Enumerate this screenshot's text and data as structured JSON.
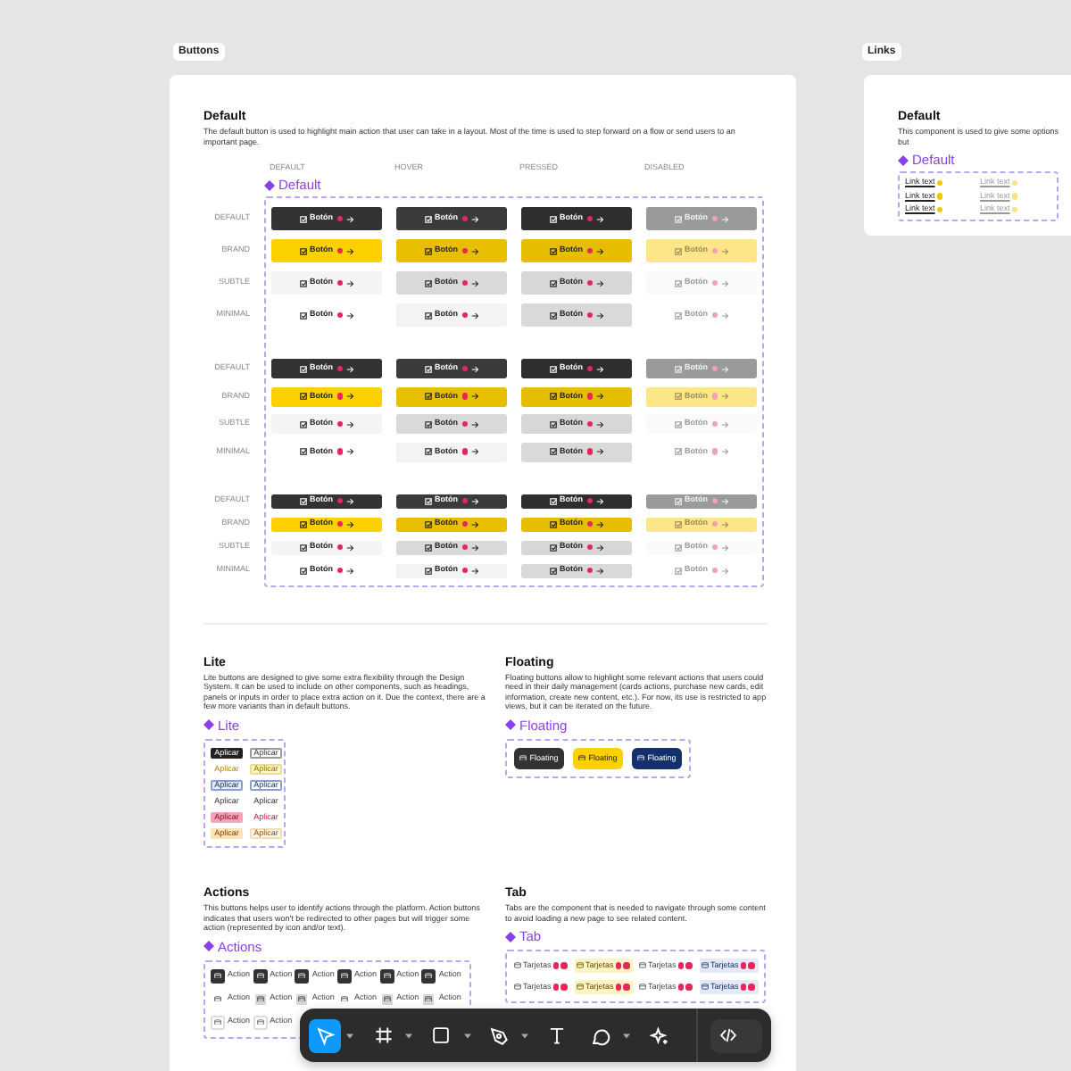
{
  "frames": [
    {
      "kind": "buttons",
      "label": "Buttons"
    },
    {
      "kind": "links",
      "label": "Links"
    }
  ],
  "buttons_page": {
    "default": {
      "title": "Default",
      "description": "The default button is used to highlight main action that user can take in a layout. Most of the time is used to step forward on a flow or send users to an important page.",
      "component": "Default",
      "columns": [
        {
          "label": "DEFAULT"
        },
        {
          "label": "HOVER"
        },
        {
          "label": "PRESSED"
        },
        {
          "label": "DISABLED"
        }
      ],
      "groups": [
        {
          "kind": "large",
          "rows": [
            {
              "label": "DEFAULT",
              "kind": "default",
              "buttons": [
                "Botón",
                "Botón",
                "Botón",
                "Botón"
              ]
            },
            {
              "label": "BRAND",
              "kind": "brand",
              "buttons": [
                "Botón",
                "Botón",
                "Botón",
                "Botón"
              ]
            },
            {
              "label": "SUBTLE",
              "kind": "subtle",
              "buttons": [
                "Botón",
                "Botón",
                "Botón",
                "Botón"
              ]
            },
            {
              "label": "MINIMAL",
              "kind": "minimal",
              "buttons": [
                "Botón",
                "Botón",
                "Botón",
                "Botón"
              ]
            }
          ]
        },
        {
          "kind": "medium",
          "rows": [
            {
              "label": "DEFAULT",
              "kind": "default",
              "buttons": [
                "Botón",
                "Botón",
                "Botón",
                "Botón"
              ]
            },
            {
              "label": "BRAND",
              "kind": "brand",
              "buttons": [
                "Botón",
                "Botón",
                "Botón",
                "Botón"
              ]
            },
            {
              "label": "SUBTLE",
              "kind": "subtle",
              "buttons": [
                "Botón",
                "Botón",
                "Botón",
                "Botón"
              ]
            },
            {
              "label": "MINIMAL",
              "kind": "minimal",
              "buttons": [
                "Botón",
                "Botón",
                "Botón",
                "Botón"
              ]
            }
          ]
        },
        {
          "kind": "small",
          "rows": [
            {
              "label": "DEFAULT",
              "kind": "default",
              "buttons": [
                "Botón",
                "Botón",
                "Botón",
                "Botón"
              ]
            },
            {
              "label": "BRAND",
              "kind": "brand",
              "buttons": [
                "Botón",
                "Botón",
                "Botón",
                "Botón"
              ]
            },
            {
              "label": "SUBTLE",
              "kind": "subtle",
              "buttons": [
                "Botón",
                "Botón",
                "Botón",
                "Botón"
              ]
            },
            {
              "label": "MINIMAL",
              "kind": "minimal",
              "buttons": [
                "Botón",
                "Botón",
                "Botón",
                "Botón"
              ]
            }
          ]
        }
      ]
    },
    "lite": {
      "title": "Lite",
      "description": "Lite buttons are designed to give some extra flexibility through the Design System. It can be used to include on other components, such as headings, panels or inputs in order to place extra action on it. Due the context, there are a few more variants than in default buttons.",
      "component": "Lite",
      "rows": [
        {
          "kind": "dark",
          "buttons": [
            "Aplicar",
            "Aplicar"
          ]
        },
        {
          "kind": "yellow",
          "buttons": [
            "Aplicar",
            "Aplicar"
          ]
        },
        {
          "kind": "blue",
          "buttons": [
            "Aplicar",
            "Aplicar"
          ]
        },
        {
          "kind": "plain",
          "buttons": [
            "Aplicar",
            "Aplicar"
          ]
        },
        {
          "kind": "pink",
          "buttons": [
            "Aplicar",
            "Aplicar"
          ]
        },
        {
          "kind": "orange",
          "buttons": [
            "Aplicar",
            "Aplicar"
          ]
        }
      ]
    },
    "floating": {
      "title": "Floating",
      "description": "Floating buttons allow to highlight some relevant actions that users could need in their daily management (cards actions, purchase new cards, edit information, create new content, etc.). For now, its use is restricted to app views, but it can be iterated on the future.",
      "component": "Floating",
      "buttons": [
        {
          "kind": "dark",
          "text": "Floating"
        },
        {
          "kind": "yellow",
          "text": "Floating"
        },
        {
          "kind": "navy",
          "text": "Floating"
        }
      ]
    },
    "actions": {
      "title": "Actions",
      "description": "This buttons helps user to identify actions through the platform. Action buttons indicates that users won't be redirected to other pages but will trigger some action (represented by icon and/or text).",
      "component": "Actions",
      "rows": [
        {
          "kind": "dark",
          "buttons": [
            "Action",
            "Action",
            "Action",
            "Action",
            "Action",
            "Action"
          ]
        },
        {
          "kind": "light",
          "buttons": [
            "Action",
            "Action",
            "Action",
            "Action",
            "Action",
            "Action"
          ]
        },
        {
          "kind": "plain",
          "buttons": [
            "Action",
            "Action"
          ]
        }
      ]
    },
    "tab": {
      "title": "Tab",
      "description": "Tabs are the component that is needed to navigate through some content to avoid loading a new page to see related content.",
      "component": "Tab",
      "rows": [
        {
          "tabs": [
            {
              "text": "Tarjetas",
              "kind": "plain"
            },
            {
              "text": "Tarjetas",
              "kind": "yellow"
            },
            {
              "text": "Tarjetas",
              "kind": "plain"
            },
            {
              "text": "Tarjetas",
              "kind": "blue"
            }
          ]
        },
        {
          "tabs": [
            {
              "text": "Tarjetas",
              "kind": "plain"
            },
            {
              "text": "Tarjetas",
              "kind": "yellow"
            },
            {
              "text": "Tarjetas",
              "kind": "plain"
            },
            {
              "text": "Tarjetas",
              "kind": "blue"
            }
          ]
        }
      ]
    }
  },
  "links_page": {
    "title": "Default",
    "description": "This component is used to give some options but",
    "component": "Default",
    "rows": [
      {
        "links": [
          {
            "text": "Link text",
            "disabled": false
          },
          {
            "text": "Link text",
            "disabled": true
          }
        ]
      },
      {
        "links": [
          {
            "text": "Link text",
            "disabled": false
          },
          {
            "text": "Link text",
            "disabled": true
          }
        ]
      },
      {
        "links": [
          {
            "text": "Link text",
            "disabled": false
          },
          {
            "text": "Link text",
            "disabled": true
          }
        ]
      }
    ]
  },
  "toolbar": {
    "tools": [
      {
        "kind": "pointer",
        "selected": true,
        "menu": true
      },
      {
        "kind": "frame",
        "selected": false,
        "menu": true
      },
      {
        "kind": "rectangle",
        "selected": false,
        "menu": true
      },
      {
        "kind": "pen",
        "selected": false,
        "menu": true
      },
      {
        "kind": "text",
        "selected": false,
        "menu": false
      },
      {
        "kind": "comment",
        "selected": false,
        "menu": true
      },
      {
        "kind": "ai",
        "selected": false,
        "menu": false
      }
    ],
    "dev_mode": {
      "on": false
    }
  }
}
